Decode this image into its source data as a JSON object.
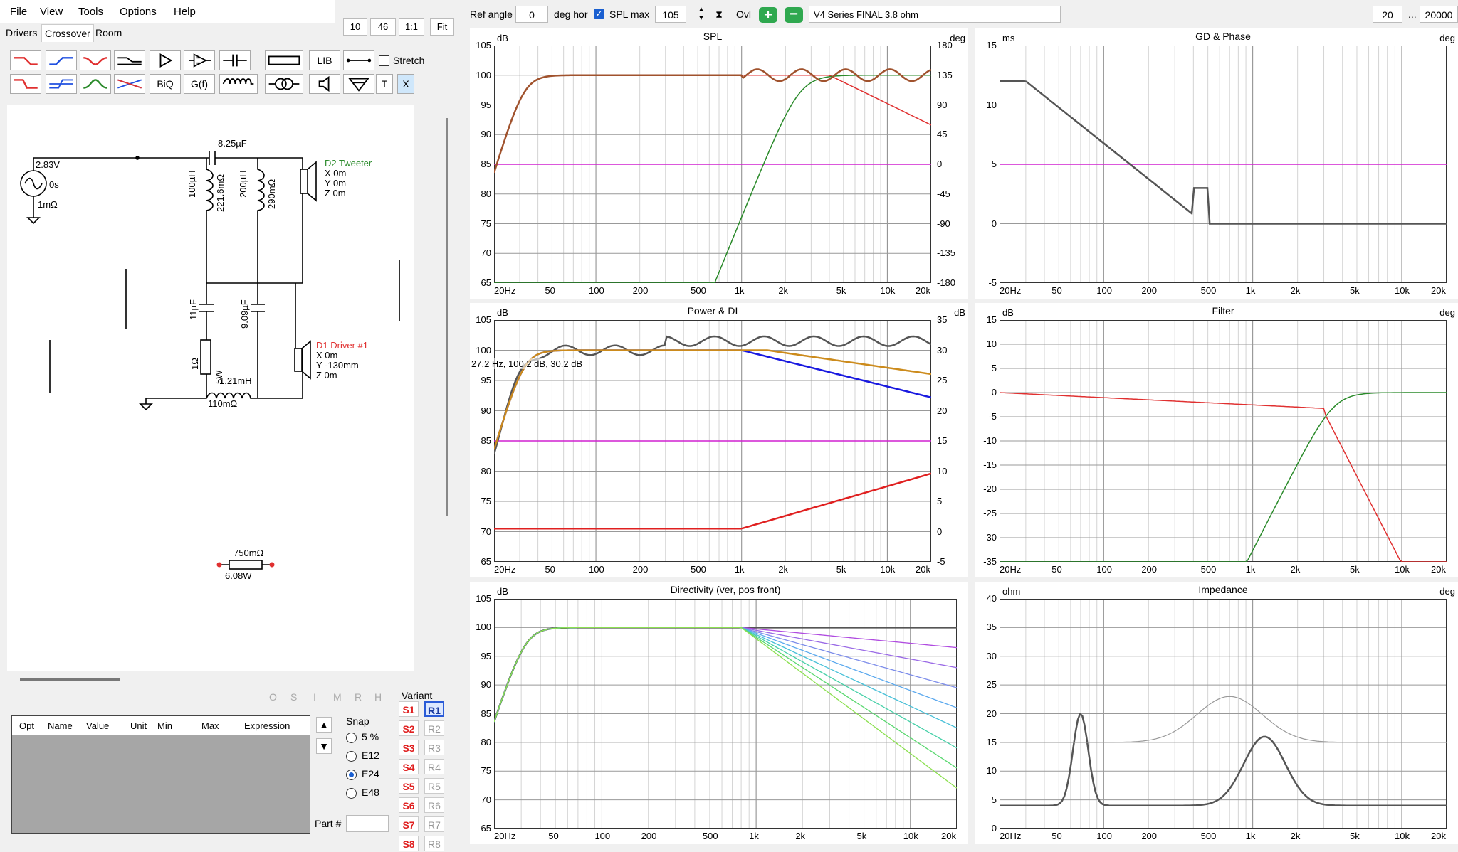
{
  "menu": [
    "File",
    "View",
    "Tools",
    "Options",
    "Help"
  ],
  "tabs": {
    "drivers": "Drivers",
    "crossover": "Crossover",
    "room": "Room"
  },
  "zoom": {
    "z10": "10",
    "z46": "46",
    "z11": "1:1",
    "fit": "Fit"
  },
  "toolbar": {
    "lib": "LIB",
    "biq": "BiQ",
    "gf": "G(f)",
    "t": "T",
    "x": "X",
    "stretch": "Stretch"
  },
  "topbar": {
    "ref_angle_label": "Ref angle",
    "ref_angle": "0",
    "deg_hor": "deg hor",
    "spl_max_label": "SPL max",
    "spl_max": "105",
    "ovl": "Ovl",
    "project": "V4 Series FINAL 3.8 ohm",
    "fmin": "20",
    "dots": "...",
    "fmax": "20000"
  },
  "schematic": {
    "source_v": "2.83V",
    "source_t": "0s",
    "source_r": "1mΩ",
    "c1": "8.25µF",
    "l1": "100µH",
    "l1r": "221.6mΩ",
    "l2": "200µH",
    "l2r": "290mΩ",
    "tweeter_name": "D2 Tweeter",
    "tweeter_x": "X 0m",
    "tweeter_y": "Y 0m",
    "tweeter_z": "Z 0m",
    "c2": "11µF",
    "c3": "9.09µF",
    "r1": "1Ω",
    "r1w": "5W",
    "l3": "1.21mH",
    "l3r": "110mΩ",
    "driver_name": "D1 Driver #1",
    "driver_x": "X 0m",
    "driver_y": "Y -130mm",
    "driver_z": "Z 0m",
    "r_loose": "750mΩ",
    "r_loose_w": "6.08W"
  },
  "optimizer": {
    "flags": [
      "O",
      "S",
      "I",
      "M",
      "R",
      "H"
    ],
    "columns": [
      "Opt",
      "Name",
      "Value",
      "Unit",
      "Min",
      "Max",
      "Expression"
    ],
    "snap_label": "Snap",
    "snap": [
      "5 %",
      "E12",
      "E24",
      "E48"
    ],
    "snap_selected": "E24",
    "part_label": "Part #",
    "variant_label": "Variant",
    "s_variants": [
      "S1",
      "S2",
      "S3",
      "S4",
      "S5",
      "S6",
      "S7",
      "S8"
    ],
    "r_variants": [
      "R1",
      "R2",
      "R3",
      "R4",
      "R5",
      "R6",
      "R7",
      "R8"
    ],
    "selected_variant": "R1"
  },
  "colors": {
    "driver": "#e03030",
    "tweeter": "#2a8a2a",
    "sum": "#a0522d",
    "target": "#d020d0"
  },
  "graphs": {
    "spl": {
      "title": "SPL",
      "unit_left": "dB",
      "unit_right": "deg",
      "y_ticks": [
        "105",
        "100",
        "95",
        "90",
        "85",
        "80",
        "75",
        "70",
        "65"
      ],
      "y_right": [
        "180",
        "135",
        "90",
        "45",
        "0",
        "-45",
        "-90",
        "-135",
        "-180"
      ]
    },
    "gd": {
      "title": "GD & Phase",
      "unit_left": "ms",
      "unit_right": "deg",
      "y_ticks": [
        "15",
        "10",
        "5",
        "0",
        "-5"
      ]
    },
    "power": {
      "title": "Power & DI",
      "unit_left": "dB",
      "unit_right": "dB",
      "y_ticks": [
        "105",
        "100",
        "95",
        "90",
        "85",
        "80",
        "75",
        "70",
        "65"
      ],
      "y_right": [
        "35",
        "30",
        "25",
        "20",
        "15",
        "10",
        "5",
        "0",
        "-5"
      ],
      "cursor": "27.2 Hz, 100.2 dB, 30.2 dB"
    },
    "filter": {
      "title": "Filter",
      "unit_left": "dB",
      "unit_right": "deg",
      "y_ticks": [
        "15",
        "10",
        "5",
        "0",
        "-5",
        "-10",
        "-15",
        "-20",
        "-25",
        "-30",
        "-35"
      ]
    },
    "directivity": {
      "title": "Directivity (ver, pos front)",
      "unit_left": "dB",
      "y_ticks": [
        "105",
        "100",
        "95",
        "90",
        "85",
        "80",
        "75",
        "70",
        "65"
      ]
    },
    "impedance": {
      "title": "Impedance",
      "unit_left": "ohm",
      "unit_right": "deg",
      "y_ticks": [
        "40",
        "35",
        "30",
        "25",
        "20",
        "15",
        "10",
        "5",
        "0"
      ]
    },
    "x_ticks": [
      "20Hz",
      "50",
      "100",
      "200",
      "500",
      "1k",
      "2k",
      "5k",
      "10k",
      "20k"
    ],
    "x_ticks_cut": [
      "20Hz",
      "50",
      "100",
      "200",
      "500",
      "1k",
      "2k",
      "5k",
      "10k",
      "20k"
    ]
  }
}
